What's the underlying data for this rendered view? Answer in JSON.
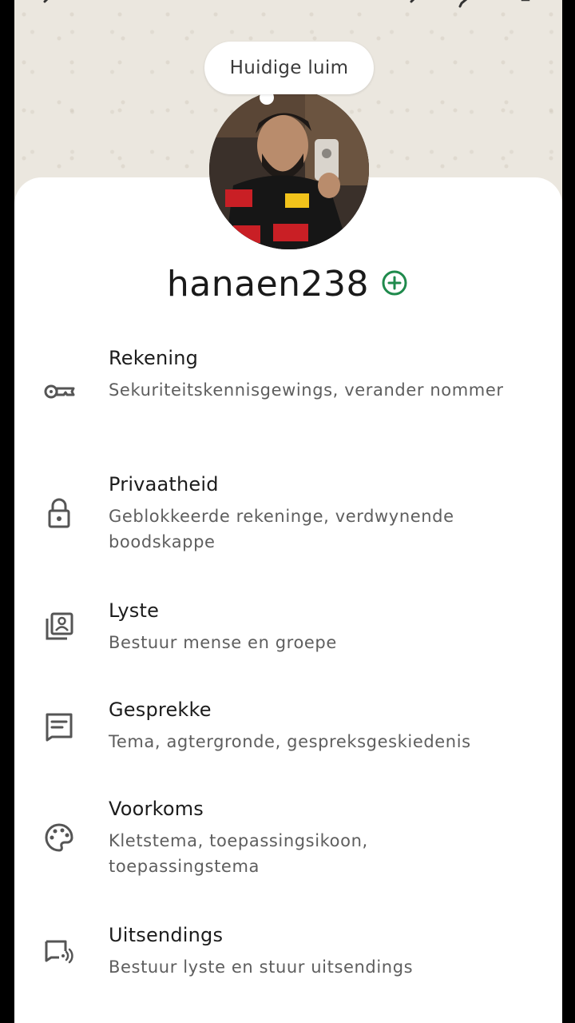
{
  "header": {
    "mood_label": "Huidige luim"
  },
  "profile": {
    "username": "hanaen238"
  },
  "settings": {
    "items": [
      {
        "title": "Rekening",
        "subtitle": "Sekuriteitskennisgewings, verander nommer",
        "icon": "key-icon"
      },
      {
        "title": "Privaatheid",
        "subtitle": "Geblokkeerde rekeninge, verdwynende boodskappe",
        "icon": "lock-icon"
      },
      {
        "title": "Lyste",
        "subtitle": "Bestuur mense en groepe",
        "icon": "contact-list-icon"
      },
      {
        "title": "Gesprekke",
        "subtitle": "Tema, agtergronde, gespreksgeskiedenis",
        "icon": "chat-icon"
      },
      {
        "title": "Voorkoms",
        "subtitle": "Kletstema, toepassingsikoon, toepassingstema",
        "icon": "palette-icon"
      },
      {
        "title": "Uitsendings",
        "subtitle": "Bestuur lyste en stuur uitsendings",
        "icon": "broadcast-icon"
      }
    ]
  },
  "colors": {
    "accent": "#1f8a4c",
    "header_bg": "#ebe7df",
    "card_bg": "#ffffff"
  }
}
